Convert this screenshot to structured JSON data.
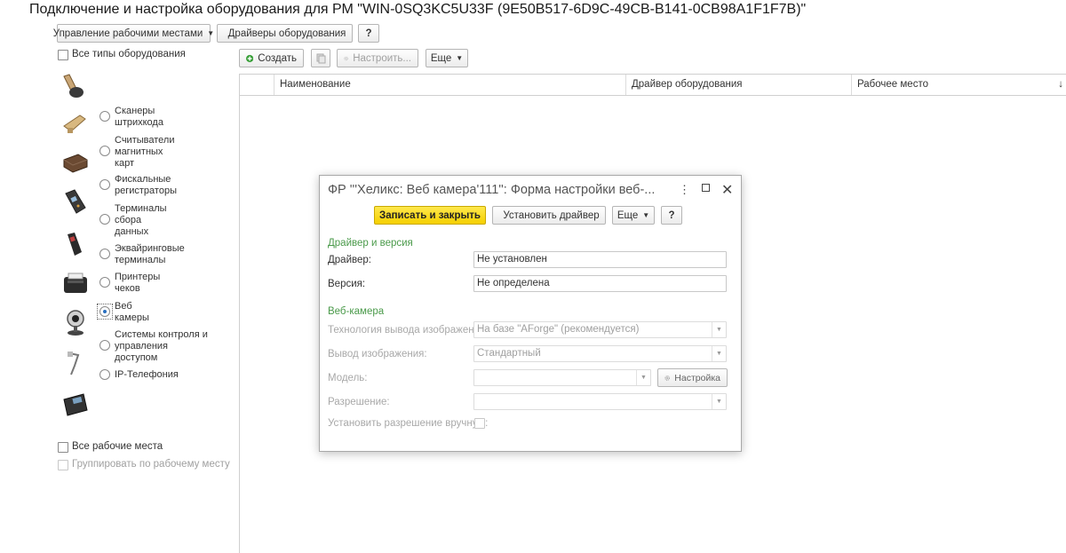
{
  "page_title": "Подключение и настройка оборудования для РМ \"WIN-0SQ3KC5U33F (9E50B517-6D9C-49CB-B141-0CB98A1F1F7B)\"",
  "top_toolbar": {
    "workplaces_label": "Управление рабочими местами",
    "drivers_label": "Драйверы оборудования",
    "help_label": "?"
  },
  "filters": {
    "all_types_label": "Все типы оборудования",
    "all_workplaces_label": "Все рабочие места",
    "group_by_workplace_label": "Группировать по рабочему месту"
  },
  "equipment_types": [
    {
      "label": "Сканеры штрихкода",
      "icon": "barcode-scanner-icon",
      "selected": false
    },
    {
      "label": "Считыватели магнитных карт",
      "icon": "card-reader-icon",
      "selected": false
    },
    {
      "label": "Фискальные регистраторы",
      "icon": "fiscal-register-icon",
      "selected": false
    },
    {
      "label": "Терминалы сбора данных",
      "icon": "data-terminal-icon",
      "selected": false
    },
    {
      "label": "Эквайринговые терминалы",
      "icon": "acquiring-terminal-icon",
      "selected": false
    },
    {
      "label": "Принтеры чеков",
      "icon": "receipt-printer-icon",
      "selected": false
    },
    {
      "label": "Веб камеры",
      "icon": "webcam-icon",
      "selected": true
    },
    {
      "label": "Системы контроля и управления доступом",
      "icon": "access-control-icon",
      "selected": false
    },
    {
      "label": "IP-Телефония",
      "icon": "ip-phone-icon",
      "selected": false
    }
  ],
  "list_toolbar": {
    "create_label": "Создать",
    "configure_label": "Настроить...",
    "more_label": "Еще"
  },
  "grid": {
    "columns": [
      "Наименование",
      "Драйвер оборудования",
      "Рабочее место"
    ],
    "sort_indicator": "↓"
  },
  "dialog": {
    "title": "ФР '''Хеликс: Веб камера'111'': Форма настройки веб-...",
    "save_close_label": "Записать и закрыть",
    "install_driver_label": "Установить драйвер",
    "more_label": "Еще",
    "help_label": "?",
    "section_driver": "Драйвер и версия",
    "driver_label": "Драйвер:",
    "driver_value": "Не установлен",
    "version_label": "Версия:",
    "version_value": "Не определена",
    "section_webcam": "Веб-камера",
    "tech_label": "Технология вывода изображения:",
    "tech_value": "На базе \"AForge\" (рекомендуется)",
    "output_label": "Вывод изображения:",
    "output_value": "Стандартный",
    "model_label": "Модель:",
    "model_value": "",
    "settings_label": "Настройка",
    "resolution_label": "Разрешение:",
    "resolution_value": "",
    "manual_resolution_label": "Установить разрешение вручную:"
  }
}
